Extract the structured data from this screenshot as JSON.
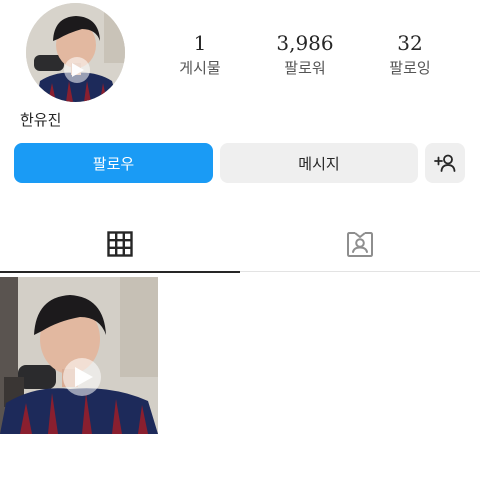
{
  "profile": {
    "name": "한유진",
    "avatar": "profile-photo"
  },
  "stats": [
    {
      "value": "1",
      "label": "게시물"
    },
    {
      "value": "3,986",
      "label": "팔로워"
    },
    {
      "value": "32",
      "label": "팔로잉"
    }
  ],
  "actions": {
    "follow_label": "팔로우",
    "message_label": "메시지",
    "add_person_icon": "person-add-icon"
  },
  "tabs": [
    {
      "icon": "grid-icon",
      "active": true
    },
    {
      "icon": "tagged-person-icon",
      "active": false
    }
  ],
  "posts": [
    {
      "type": "video",
      "icon": "play-icon"
    }
  ],
  "colors": {
    "accent": "#1a9bf5",
    "secondary_button": "#efefef",
    "text": "#262626"
  }
}
